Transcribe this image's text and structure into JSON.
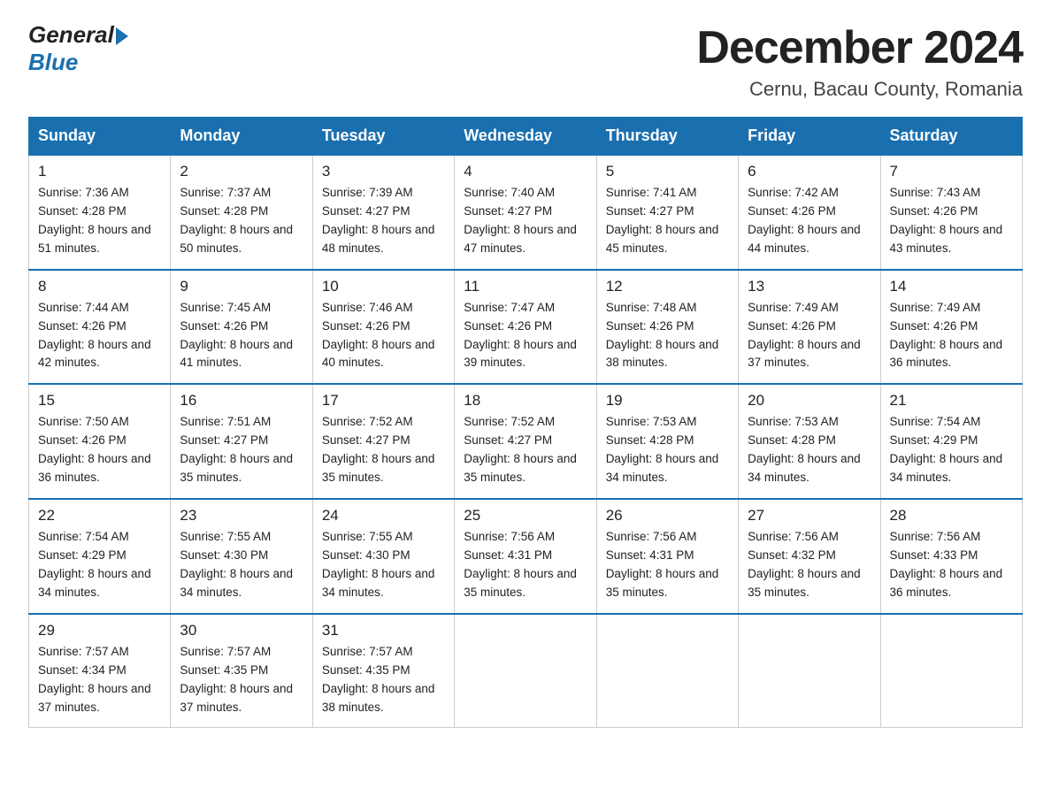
{
  "header": {
    "logo_general": "General",
    "logo_blue": "Blue",
    "month_title": "December 2024",
    "location": "Cernu, Bacau County, Romania"
  },
  "weekdays": [
    "Sunday",
    "Monday",
    "Tuesday",
    "Wednesday",
    "Thursday",
    "Friday",
    "Saturday"
  ],
  "weeks": [
    [
      {
        "day": "1",
        "sunrise": "Sunrise: 7:36 AM",
        "sunset": "Sunset: 4:28 PM",
        "daylight": "Daylight: 8 hours and 51 minutes."
      },
      {
        "day": "2",
        "sunrise": "Sunrise: 7:37 AM",
        "sunset": "Sunset: 4:28 PM",
        "daylight": "Daylight: 8 hours and 50 minutes."
      },
      {
        "day": "3",
        "sunrise": "Sunrise: 7:39 AM",
        "sunset": "Sunset: 4:27 PM",
        "daylight": "Daylight: 8 hours and 48 minutes."
      },
      {
        "day": "4",
        "sunrise": "Sunrise: 7:40 AM",
        "sunset": "Sunset: 4:27 PM",
        "daylight": "Daylight: 8 hours and 47 minutes."
      },
      {
        "day": "5",
        "sunrise": "Sunrise: 7:41 AM",
        "sunset": "Sunset: 4:27 PM",
        "daylight": "Daylight: 8 hours and 45 minutes."
      },
      {
        "day": "6",
        "sunrise": "Sunrise: 7:42 AM",
        "sunset": "Sunset: 4:26 PM",
        "daylight": "Daylight: 8 hours and 44 minutes."
      },
      {
        "day": "7",
        "sunrise": "Sunrise: 7:43 AM",
        "sunset": "Sunset: 4:26 PM",
        "daylight": "Daylight: 8 hours and 43 minutes."
      }
    ],
    [
      {
        "day": "8",
        "sunrise": "Sunrise: 7:44 AM",
        "sunset": "Sunset: 4:26 PM",
        "daylight": "Daylight: 8 hours and 42 minutes."
      },
      {
        "day": "9",
        "sunrise": "Sunrise: 7:45 AM",
        "sunset": "Sunset: 4:26 PM",
        "daylight": "Daylight: 8 hours and 41 minutes."
      },
      {
        "day": "10",
        "sunrise": "Sunrise: 7:46 AM",
        "sunset": "Sunset: 4:26 PM",
        "daylight": "Daylight: 8 hours and 40 minutes."
      },
      {
        "day": "11",
        "sunrise": "Sunrise: 7:47 AM",
        "sunset": "Sunset: 4:26 PM",
        "daylight": "Daylight: 8 hours and 39 minutes."
      },
      {
        "day": "12",
        "sunrise": "Sunrise: 7:48 AM",
        "sunset": "Sunset: 4:26 PM",
        "daylight": "Daylight: 8 hours and 38 minutes."
      },
      {
        "day": "13",
        "sunrise": "Sunrise: 7:49 AM",
        "sunset": "Sunset: 4:26 PM",
        "daylight": "Daylight: 8 hours and 37 minutes."
      },
      {
        "day": "14",
        "sunrise": "Sunrise: 7:49 AM",
        "sunset": "Sunset: 4:26 PM",
        "daylight": "Daylight: 8 hours and 36 minutes."
      }
    ],
    [
      {
        "day": "15",
        "sunrise": "Sunrise: 7:50 AM",
        "sunset": "Sunset: 4:26 PM",
        "daylight": "Daylight: 8 hours and 36 minutes."
      },
      {
        "day": "16",
        "sunrise": "Sunrise: 7:51 AM",
        "sunset": "Sunset: 4:27 PM",
        "daylight": "Daylight: 8 hours and 35 minutes."
      },
      {
        "day": "17",
        "sunrise": "Sunrise: 7:52 AM",
        "sunset": "Sunset: 4:27 PM",
        "daylight": "Daylight: 8 hours and 35 minutes."
      },
      {
        "day": "18",
        "sunrise": "Sunrise: 7:52 AM",
        "sunset": "Sunset: 4:27 PM",
        "daylight": "Daylight: 8 hours and 35 minutes."
      },
      {
        "day": "19",
        "sunrise": "Sunrise: 7:53 AM",
        "sunset": "Sunset: 4:28 PM",
        "daylight": "Daylight: 8 hours and 34 minutes."
      },
      {
        "day": "20",
        "sunrise": "Sunrise: 7:53 AM",
        "sunset": "Sunset: 4:28 PM",
        "daylight": "Daylight: 8 hours and 34 minutes."
      },
      {
        "day": "21",
        "sunrise": "Sunrise: 7:54 AM",
        "sunset": "Sunset: 4:29 PM",
        "daylight": "Daylight: 8 hours and 34 minutes."
      }
    ],
    [
      {
        "day": "22",
        "sunrise": "Sunrise: 7:54 AM",
        "sunset": "Sunset: 4:29 PM",
        "daylight": "Daylight: 8 hours and 34 minutes."
      },
      {
        "day": "23",
        "sunrise": "Sunrise: 7:55 AM",
        "sunset": "Sunset: 4:30 PM",
        "daylight": "Daylight: 8 hours and 34 minutes."
      },
      {
        "day": "24",
        "sunrise": "Sunrise: 7:55 AM",
        "sunset": "Sunset: 4:30 PM",
        "daylight": "Daylight: 8 hours and 34 minutes."
      },
      {
        "day": "25",
        "sunrise": "Sunrise: 7:56 AM",
        "sunset": "Sunset: 4:31 PM",
        "daylight": "Daylight: 8 hours and 35 minutes."
      },
      {
        "day": "26",
        "sunrise": "Sunrise: 7:56 AM",
        "sunset": "Sunset: 4:31 PM",
        "daylight": "Daylight: 8 hours and 35 minutes."
      },
      {
        "day": "27",
        "sunrise": "Sunrise: 7:56 AM",
        "sunset": "Sunset: 4:32 PM",
        "daylight": "Daylight: 8 hours and 35 minutes."
      },
      {
        "day": "28",
        "sunrise": "Sunrise: 7:56 AM",
        "sunset": "Sunset: 4:33 PM",
        "daylight": "Daylight: 8 hours and 36 minutes."
      }
    ],
    [
      {
        "day": "29",
        "sunrise": "Sunrise: 7:57 AM",
        "sunset": "Sunset: 4:34 PM",
        "daylight": "Daylight: 8 hours and 37 minutes."
      },
      {
        "day": "30",
        "sunrise": "Sunrise: 7:57 AM",
        "sunset": "Sunset: 4:35 PM",
        "daylight": "Daylight: 8 hours and 37 minutes."
      },
      {
        "day": "31",
        "sunrise": "Sunrise: 7:57 AM",
        "sunset": "Sunset: 4:35 PM",
        "daylight": "Daylight: 8 hours and 38 minutes."
      },
      null,
      null,
      null,
      null
    ]
  ]
}
